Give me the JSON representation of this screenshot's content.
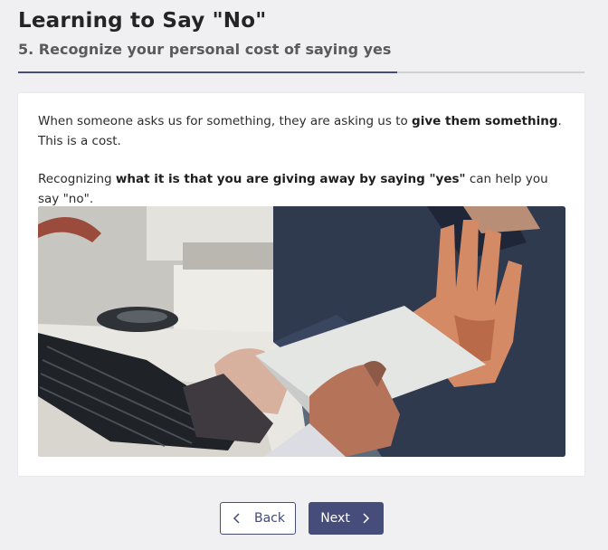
{
  "header": {
    "title": "Learning to Say \"No\"",
    "subtitle": "5. Recognize your personal cost of saying yes"
  },
  "progress": {
    "fraction": 0.67
  },
  "content": {
    "p1_before": "When someone asks us for something, they are asking us to ",
    "p1_bold": "give them something",
    "p1_after": ". This is a cost.",
    "p2_before": "Recognizing ",
    "p2_bold": "what it is that you are giving away by saying \"yes\"",
    "p2_after": " can help you say \"no\"."
  },
  "image": {
    "description_icon": "photo-hand-refusing-envelope"
  },
  "nav": {
    "back_label": "Back",
    "next_label": "Next",
    "back_icon": "chevron-left-icon",
    "next_icon": "chevron-right-icon"
  },
  "colors": {
    "accent": "#474d7a",
    "background": "#f0f0f3",
    "card": "#ffffff"
  }
}
